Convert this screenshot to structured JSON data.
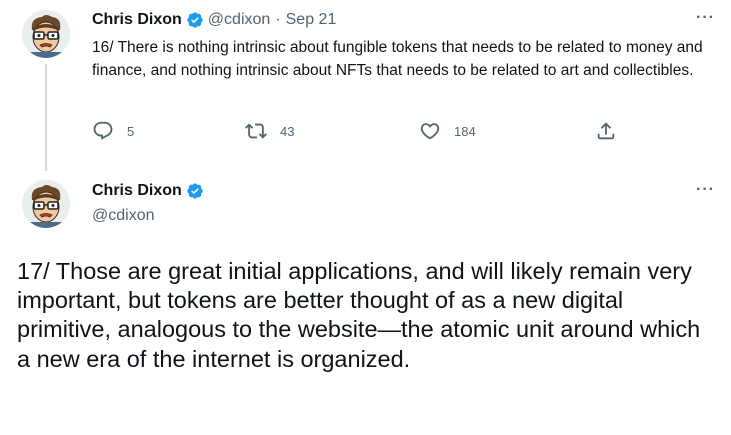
{
  "tweet1": {
    "author_name": "Chris Dixon",
    "author_handle": "@cdixon",
    "separator": "·",
    "date": "Sep 21",
    "text": "16/ There is nothing intrinsic about fungible tokens that needs to be related to money and finance, and nothing intrinsic about NFTs that needs to be related to art and collectibles.",
    "more_icon": "more-horizontal-icon",
    "actions": {
      "replies": "5",
      "retweets": "43",
      "likes": "184"
    }
  },
  "tweet2": {
    "author_name": "Chris Dixon",
    "author_handle": "@cdixon",
    "more_icon": "more-horizontal-icon",
    "text": "17/ Those are great initial applications, and will likely remain very important, but tokens are better thought of as a new digital primitive, analogous to the website—the atomic unit around which a new era of the internet is organized."
  },
  "colors": {
    "verified": "#1d9bf0",
    "secondary_text": "#536471",
    "primary_text": "#0f1419",
    "thread_line": "#cfd9de"
  }
}
